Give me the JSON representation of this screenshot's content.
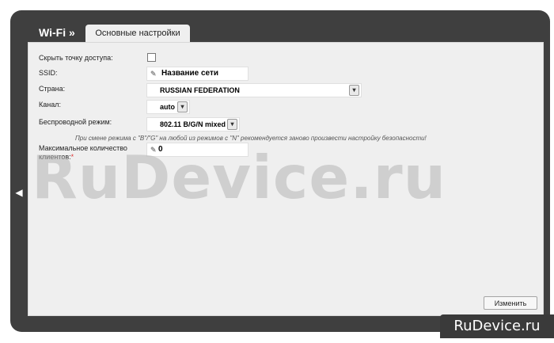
{
  "header": {
    "breadcrumb": "Wi-Fi »",
    "tab_label": "Основные настройки"
  },
  "form": {
    "hide_ap_label": "Скрыть точку доступа:",
    "ssid_label": "SSID:",
    "ssid_value": "Название сети",
    "country_label": "Страна:",
    "country_value": "RUSSIAN FEDERATION",
    "channel_label": "Канал:",
    "channel_value": "auto",
    "mode_label": "Беспроводной режим:",
    "mode_value": "802.11 B/G/N mixed",
    "hint": "При смене режима с \"B\"/\"G\" на любой из режимов с \"N\" рекомендуется заново произвести настройку безопасности!",
    "max_clients_label_line1": "Максимальное количество",
    "max_clients_label_line2": "клиентов:",
    "max_clients_required": "*",
    "max_clients_value": "0"
  },
  "actions": {
    "apply_label": "Изменить"
  },
  "watermark": {
    "text": "RuDevice.ru"
  },
  "brand": {
    "badge_text": "RuDevice.ru"
  },
  "icons": {
    "pencil": "pencil-icon",
    "dropdown": "chevron-down-icon",
    "back": "chevron-left-icon"
  }
}
